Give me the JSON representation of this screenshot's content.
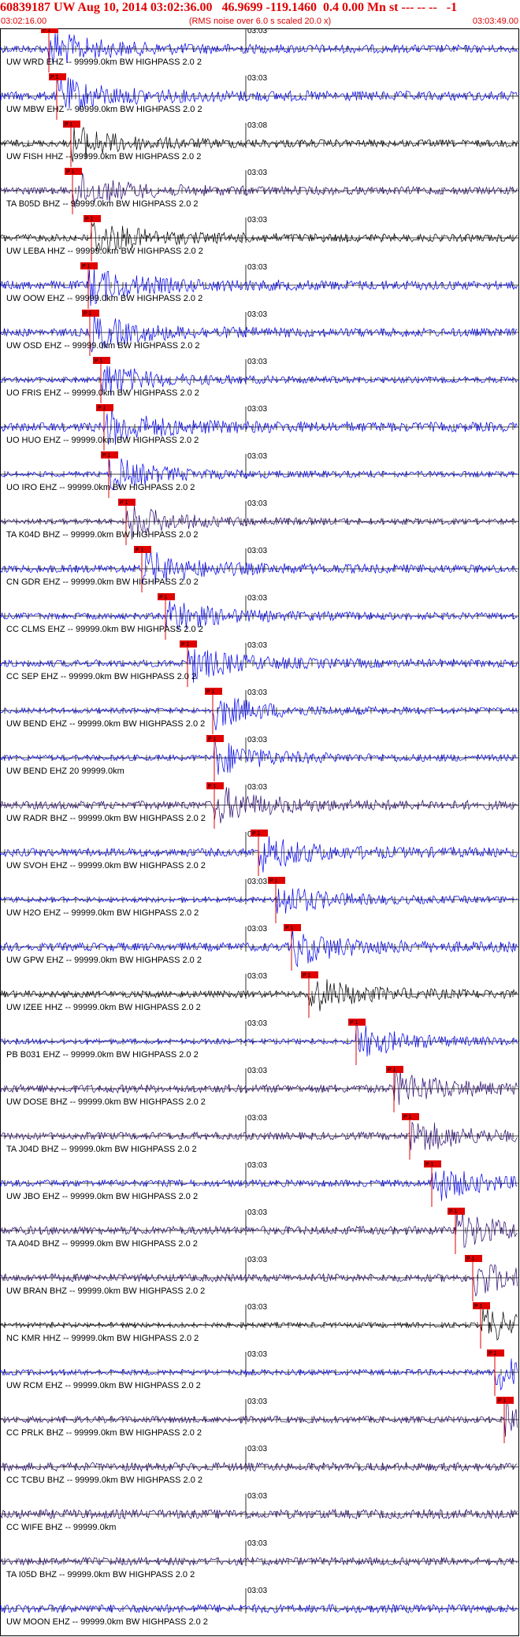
{
  "header": {
    "title": "60839187 UW Aug 10, 2014 03:02:36.00   46.9699 -119.1460  0.4 0.00 Mn st --- -- --   -1",
    "start_time": "03:02:16.00",
    "note": "(RMS noise over 6.0 s scaled 20.0 x)",
    "end_time": "03:03:49.00"
  },
  "minute_label": "03:03",
  "pick_label": "P 1",
  "colors": {
    "accent": "#e00000",
    "blue": "#0000ee",
    "purple": "#2a0a6e",
    "black": "#000000"
  },
  "traces": [
    {
      "label": "UW WRD EHZ -- 99999.0km BW  HIGHPASS  2.0  2",
      "color": "#0000ee"
    },
    {
      "label": "UW MBW EHZ -- 99999.0km BW  HIGHPASS  2.0  2",
      "color": "#0000ee"
    },
    {
      "label": "UW FISH HHZ -- 99999.0km BW  HIGHPASS  2.0  2",
      "color": "#000000",
      "minute": "03:08"
    },
    {
      "label": "TA B05D BHZ -- 99999.0km BW  HIGHPASS  2.0  2",
      "color": "#2a0a6e"
    },
    {
      "label": "UW LEBA HHZ -- 99999.0km BW  HIGHPASS  2.0  2",
      "color": "#000000"
    },
    {
      "label": "UW OOW EHZ -- 99999.0km BW  HIGHPASS  2.0  2",
      "color": "#0000ee"
    },
    {
      "label": "UW OSD EHZ -- 99999.0km BW  HIGHPASS  2.0  2",
      "color": "#0000ee"
    },
    {
      "label": "UO FRIS EHZ -- 99999.0km BW  HIGHPASS  2.0  2",
      "color": "#0000ee"
    },
    {
      "label": "UO HUO EHZ -- 99999.0km BW  HIGHPASS  2.0  2",
      "color": "#0000ee"
    },
    {
      "label": "UO IRO EHZ -- 99999.0km BW  HIGHPASS  2.0  2",
      "color": "#0000ee"
    },
    {
      "label": "TA K04D BHZ -- 99999.0km BW  HIGHPASS  2.0  2",
      "color": "#2a0a6e"
    },
    {
      "label": "CN GDR EHZ -- 99999.0km BW  HIGHPASS  2.0  2",
      "color": "#0000ee"
    },
    {
      "label": "CC CLMS EHZ -- 99999.0km BW  HIGHPASS  2.0  2",
      "color": "#0000ee"
    },
    {
      "label": "CC SEP EHZ -- 99999.0km BW  HIGHPASS  2.0  2",
      "color": "#0000ee"
    },
    {
      "label": "UW BEND EHZ -- 99999.0km BW  HIGHPASS  2.0  2",
      "color": "#0000ee"
    },
    {
      "label": "UW BEND EHZ 20 99999.0km",
      "color": "#0000ee"
    },
    {
      "label": "UW RADR BHZ -- 99999.0km BW  HIGHPASS  2.0  2",
      "color": "#2a0a6e"
    },
    {
      "label": "UW SVOH EHZ -- 99999.0km BW  HIGHPASS  2.0  2",
      "color": "#0000ee"
    },
    {
      "label": "UW H2O EHZ -- 99999.0km BW  HIGHPASS  2.0  2",
      "color": "#0000ee"
    },
    {
      "label": "UW GPW EHZ -- 99999.0km BW  HIGHPASS  2.0  2",
      "color": "#0000ee"
    },
    {
      "label": "UW IZEE HHZ -- 99999.0km BW  HIGHPASS  2.0  2",
      "color": "#000000"
    },
    {
      "label": "PB B031 EHZ -- 99999.0km BW  HIGHPASS  2.0  2",
      "color": "#0000ee"
    },
    {
      "label": "UW DOSE BHZ -- 99999.0km BW  HIGHPASS  2.0  2",
      "color": "#2a0a6e"
    },
    {
      "label": "TA J04D BHZ -- 99999.0km BW  HIGHPASS  2.0  2",
      "color": "#2a0a6e"
    },
    {
      "label": "UW JBO EHZ -- 99999.0km BW  HIGHPASS  2.0  2",
      "color": "#0000ee"
    },
    {
      "label": "TA A04D BHZ -- 99999.0km BW  HIGHPASS  2.0  2",
      "color": "#2a0a6e"
    },
    {
      "label": "UW BRAN BHZ -- 99999.0km BW  HIGHPASS  2.0  2",
      "color": "#2a0a6e"
    },
    {
      "label": "NC KMR HHZ -- 99999.0km BW  HIGHPASS  2.0  2",
      "color": "#000000"
    },
    {
      "label": "UW RCM EHZ -- 99999.0km BW  HIGHPASS  2.0  2",
      "color": "#0000ee"
    },
    {
      "label": "CC PRLK BHZ -- 99999.0km BW  HIGHPASS  2.0  2",
      "color": "#2a0a6e"
    },
    {
      "label": "CC TCBU BHZ -- 99999.0km BW  HIGHPASS  2.0  2",
      "color": "#2a0a6e"
    },
    {
      "label": "CC WIFE BHZ -- 99999.0km",
      "color": "#2a0a6e"
    },
    {
      "label": "TA I05D BHZ -- 99999.0km BW  HIGHPASS  2.0  2",
      "color": "#2a0a6e"
    },
    {
      "label": "UW MOON EHZ -- 99999.0km BW  HIGHPASS  2.0  2",
      "color": "#0000ee"
    }
  ]
}
